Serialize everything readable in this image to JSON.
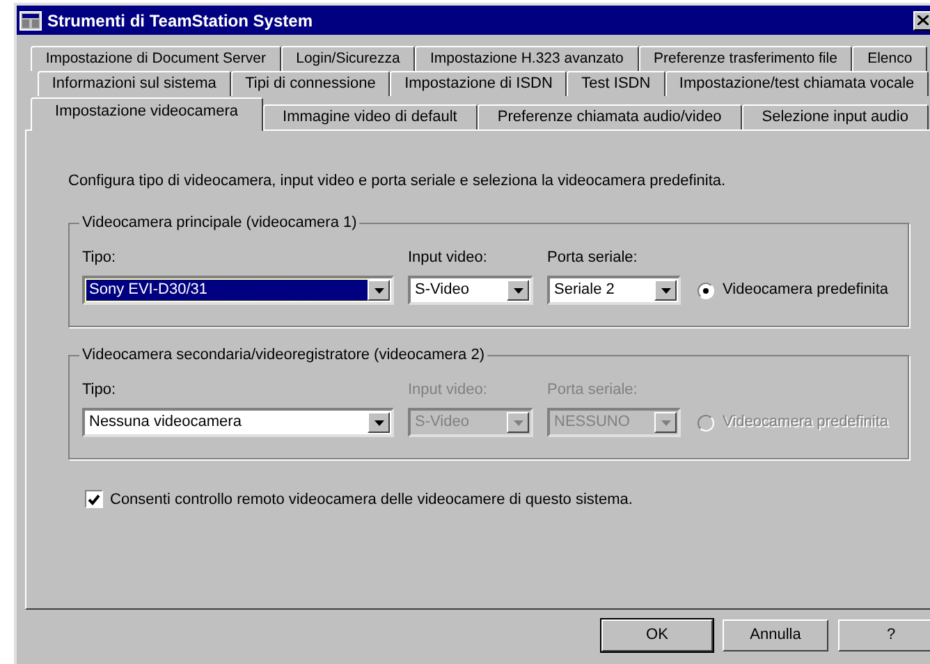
{
  "window": {
    "title": "Strumenti di TeamStation System"
  },
  "tab_rows": [
    {
      "tabs": [
        {
          "label": "Impostazione di Document Server",
          "selected": false
        },
        {
          "label": "Login/Sicurezza",
          "selected": false
        },
        {
          "label": "Impostazione H.323 avanzato",
          "selected": false
        },
        {
          "label": "Preferenze trasferimento file",
          "selected": false
        },
        {
          "label": "Elenco",
          "selected": false
        }
      ]
    },
    {
      "tabs": [
        {
          "label": "Informazioni sul sistema",
          "selected": false
        },
        {
          "label": "Tipi di connessione",
          "selected": false
        },
        {
          "label": "Impostazione di ISDN",
          "selected": false
        },
        {
          "label": "Test ISDN",
          "selected": false
        },
        {
          "label": "Impostazione/test chiamata vocale",
          "selected": false
        }
      ]
    },
    {
      "tabs": [
        {
          "label": "Impostazione videocamera",
          "selected": true
        },
        {
          "label": "Immagine video di default",
          "selected": false
        },
        {
          "label": "Preferenze chiamata audio/video",
          "selected": false
        },
        {
          "label": "Selezione input audio",
          "selected": false
        }
      ]
    }
  ],
  "description": "Configura tipo di videocamera, input video e porta seriale e seleziona la videocamera predefinita.",
  "groups": [
    {
      "title": "Videocamera principale (videocamera 1)",
      "fields": [
        {
          "label": "Tipo:",
          "value": "Sony EVI-D30/31",
          "disabled": false,
          "focused": true
        },
        {
          "label": "Input video:",
          "value": "S-Video",
          "disabled": false,
          "focused": false
        },
        {
          "label": "Porta seriale:",
          "value": "Seriale 2",
          "disabled": false,
          "focused": false
        }
      ],
      "default_camera": {
        "label": "Videocamera predefinita",
        "selected": true,
        "disabled": false
      }
    },
    {
      "title": "Videocamera secondaria/videoregistratore (videocamera 2)",
      "fields": [
        {
          "label": "Tipo:",
          "value": "Nessuna videocamera",
          "disabled": false,
          "focused": false
        },
        {
          "label": "Input video:",
          "value": "S-Video",
          "disabled": true,
          "focused": false
        },
        {
          "label": "Porta seriale:",
          "value": "NESSUNO",
          "disabled": true,
          "focused": false
        }
      ],
      "default_camera": {
        "label": "Videocamera predefinita",
        "selected": false,
        "disabled": true
      }
    }
  ],
  "remote_control": {
    "label": "Consenti controllo remoto videocamera delle videocamere di questo sistema.",
    "checked": true
  },
  "buttons": [
    {
      "label": "OK",
      "default": true
    },
    {
      "label": "Annulla",
      "default": false
    },
    {
      "label": "?",
      "default": false
    }
  ]
}
